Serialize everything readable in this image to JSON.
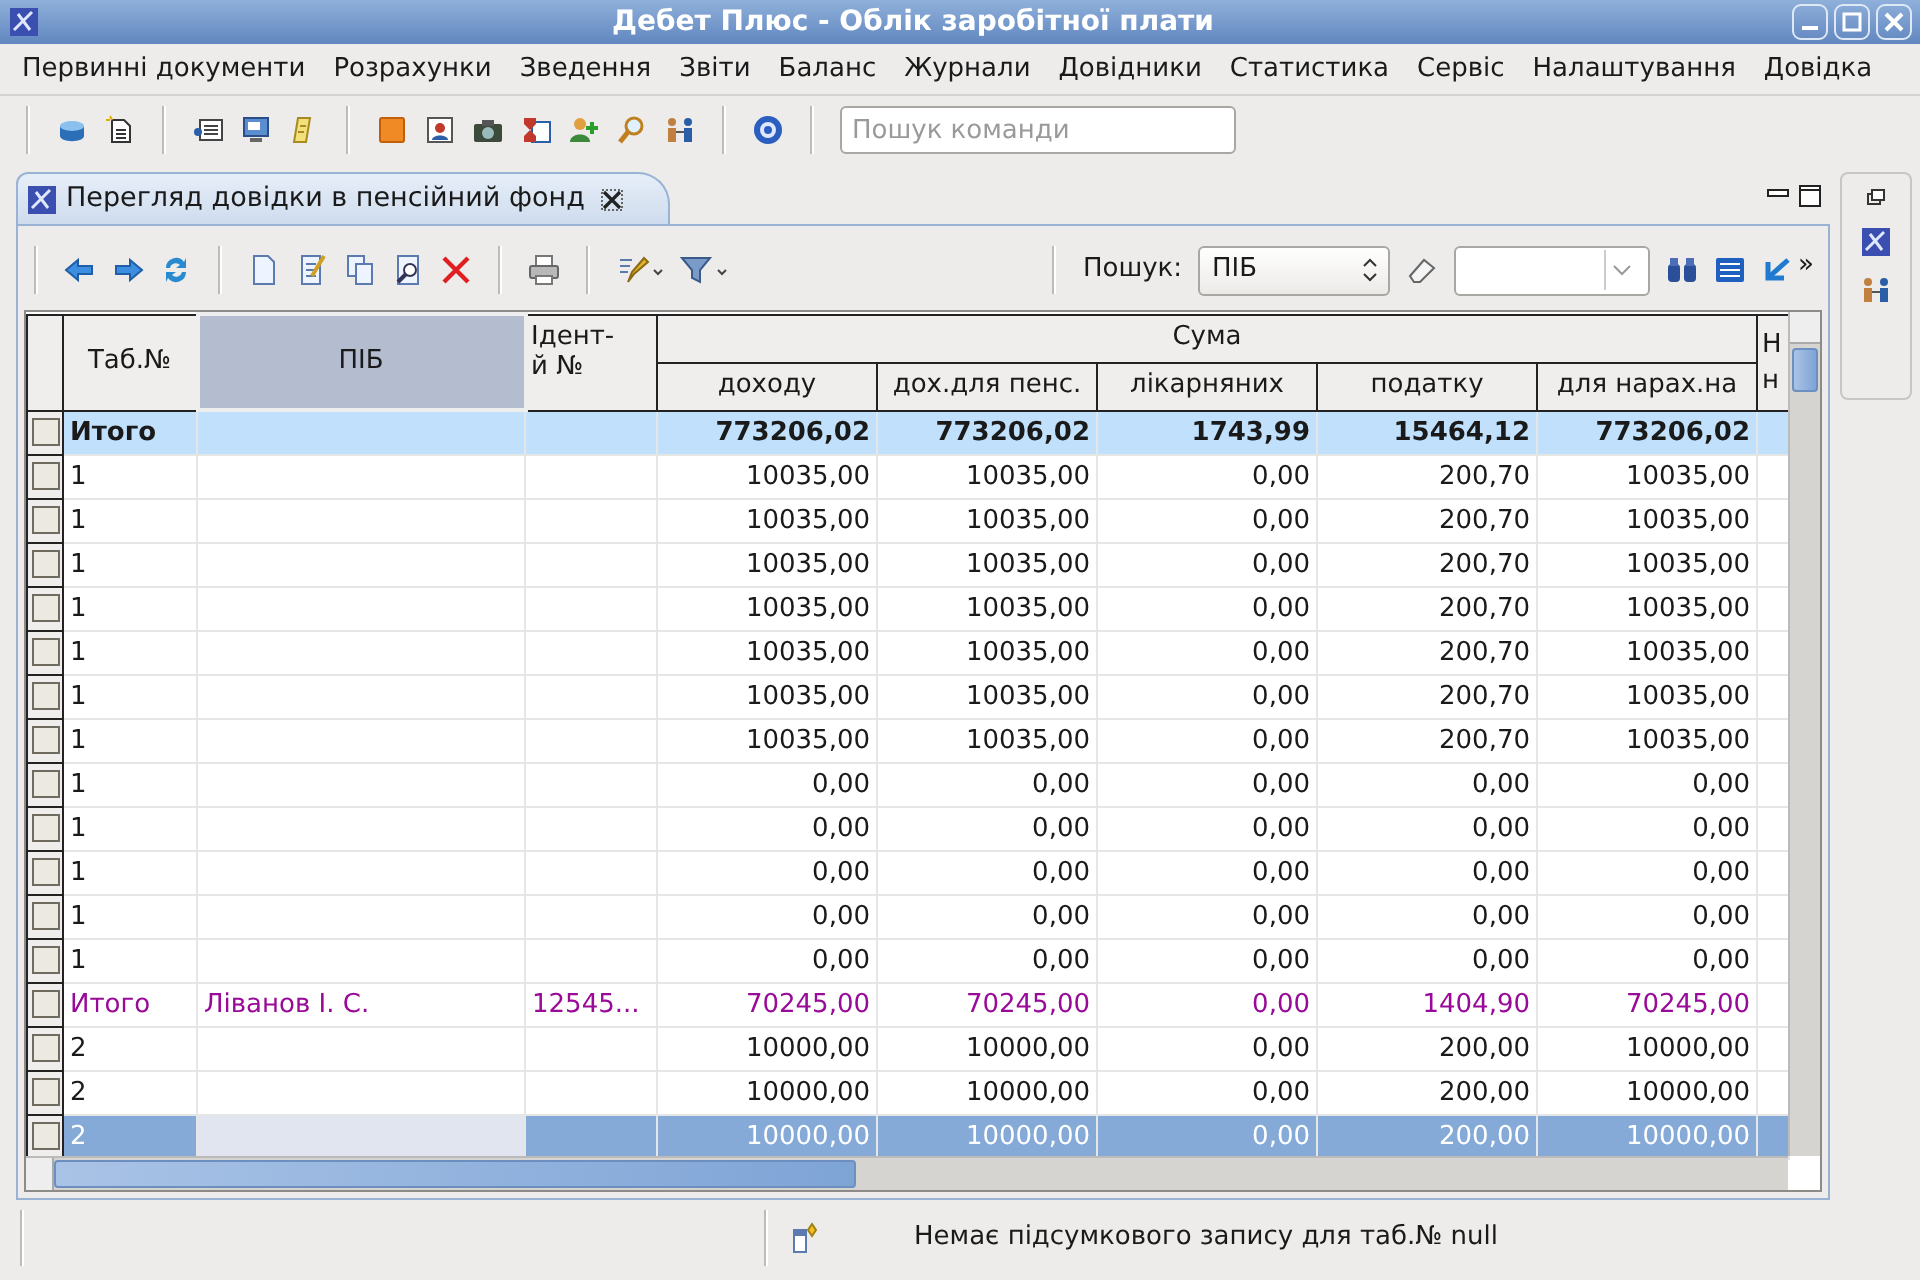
{
  "window": {
    "title": "Дебет Плюс - Облік заробітної плати"
  },
  "menu": [
    "Первинні документи",
    "Розрахунки",
    "Зведення",
    "Звіти",
    "Баланс",
    "Журнали",
    "Довідники",
    "Статистика",
    "Сервіс",
    "Налаштування",
    "Довідка"
  ],
  "command_search": {
    "placeholder": "Пошук команди"
  },
  "tab": {
    "title": "Перегляд довідки в пенсійний фонд",
    "selected": true
  },
  "search": {
    "label": "Пошук:",
    "field": "ПІБ",
    "overflow": "»"
  },
  "table": {
    "columns": [
      {
        "label": "Таб.№",
        "selected": false
      },
      {
        "label": "ПІБ",
        "selected": true
      },
      {
        "label": "Ідент-й №",
        "selected": false
      }
    ],
    "group": {
      "label": "Сума",
      "columns": [
        "доходу",
        "дох.для пенс.",
        "лікарняних",
        "податку",
        "для нарах.на"
      ]
    },
    "column_10": "Н н",
    "rows": [
      {
        "kind": "total",
        "selected": false,
        "checked": false,
        "tab": "Итого",
        "values": [
          "773206,02",
          "773206,02",
          "1743,99",
          "15464,12",
          "773206,02"
        ]
      },
      {
        "kind": "normal",
        "selected": false,
        "checked": false,
        "tab": "1",
        "values": [
          "10035,00",
          "10035,00",
          "0,00",
          "200,70",
          "10035,00"
        ]
      },
      {
        "kind": "normal",
        "selected": false,
        "checked": false,
        "tab": "1",
        "values": [
          "10035,00",
          "10035,00",
          "0,00",
          "200,70",
          "10035,00"
        ]
      },
      {
        "kind": "normal",
        "selected": false,
        "checked": false,
        "tab": "1",
        "values": [
          "10035,00",
          "10035,00",
          "0,00",
          "200,70",
          "10035,00"
        ]
      },
      {
        "kind": "normal",
        "selected": false,
        "checked": false,
        "tab": "1",
        "values": [
          "10035,00",
          "10035,00",
          "0,00",
          "200,70",
          "10035,00"
        ]
      },
      {
        "kind": "normal",
        "selected": false,
        "checked": false,
        "tab": "1",
        "values": [
          "10035,00",
          "10035,00",
          "0,00",
          "200,70",
          "10035,00"
        ]
      },
      {
        "kind": "normal",
        "selected": false,
        "checked": false,
        "tab": "1",
        "values": [
          "10035,00",
          "10035,00",
          "0,00",
          "200,70",
          "10035,00"
        ]
      },
      {
        "kind": "normal",
        "selected": false,
        "checked": false,
        "tab": "1",
        "values": [
          "10035,00",
          "10035,00",
          "0,00",
          "200,70",
          "10035,00"
        ]
      },
      {
        "kind": "normal",
        "selected": false,
        "checked": false,
        "tab": "1",
        "values": [
          "0,00",
          "0,00",
          "0,00",
          "0,00",
          "0,00"
        ]
      },
      {
        "kind": "normal",
        "selected": false,
        "checked": false,
        "tab": "1",
        "values": [
          "0,00",
          "0,00",
          "0,00",
          "0,00",
          "0,00"
        ]
      },
      {
        "kind": "normal",
        "selected": false,
        "checked": false,
        "tab": "1",
        "values": [
          "0,00",
          "0,00",
          "0,00",
          "0,00",
          "0,00"
        ]
      },
      {
        "kind": "normal",
        "selected": false,
        "checked": false,
        "tab": "1",
        "values": [
          "0,00",
          "0,00",
          "0,00",
          "0,00",
          "0,00"
        ]
      },
      {
        "kind": "normal",
        "selected": false,
        "checked": false,
        "tab": "1",
        "values": [
          "0,00",
          "0,00",
          "0,00",
          "0,00",
          "0,00"
        ]
      },
      {
        "kind": "subtotal",
        "selected": false,
        "checked": false,
        "tab": "Итого",
        "name": "Ліванов І. С.",
        "ident": "12545...",
        "values": [
          "70245,00",
          "70245,00",
          "0,00",
          "1404,90",
          "70245,00"
        ]
      },
      {
        "kind": "normal",
        "selected": false,
        "checked": false,
        "tab": "2",
        "values": [
          "10000,00",
          "10000,00",
          "0,00",
          "200,00",
          "10000,00"
        ]
      },
      {
        "kind": "normal",
        "selected": false,
        "checked": false,
        "tab": "2",
        "values": [
          "10000,00",
          "10000,00",
          "0,00",
          "200,00",
          "10000,00"
        ]
      },
      {
        "kind": "normal",
        "selected": true,
        "checked": false,
        "tab": "2",
        "values": [
          "10000,00",
          "10000,00",
          "0,00",
          "200,00",
          "10000,00"
        ]
      }
    ]
  },
  "status_bar": {
    "message": "Немає підсумкового запису для таб.№ null"
  }
}
